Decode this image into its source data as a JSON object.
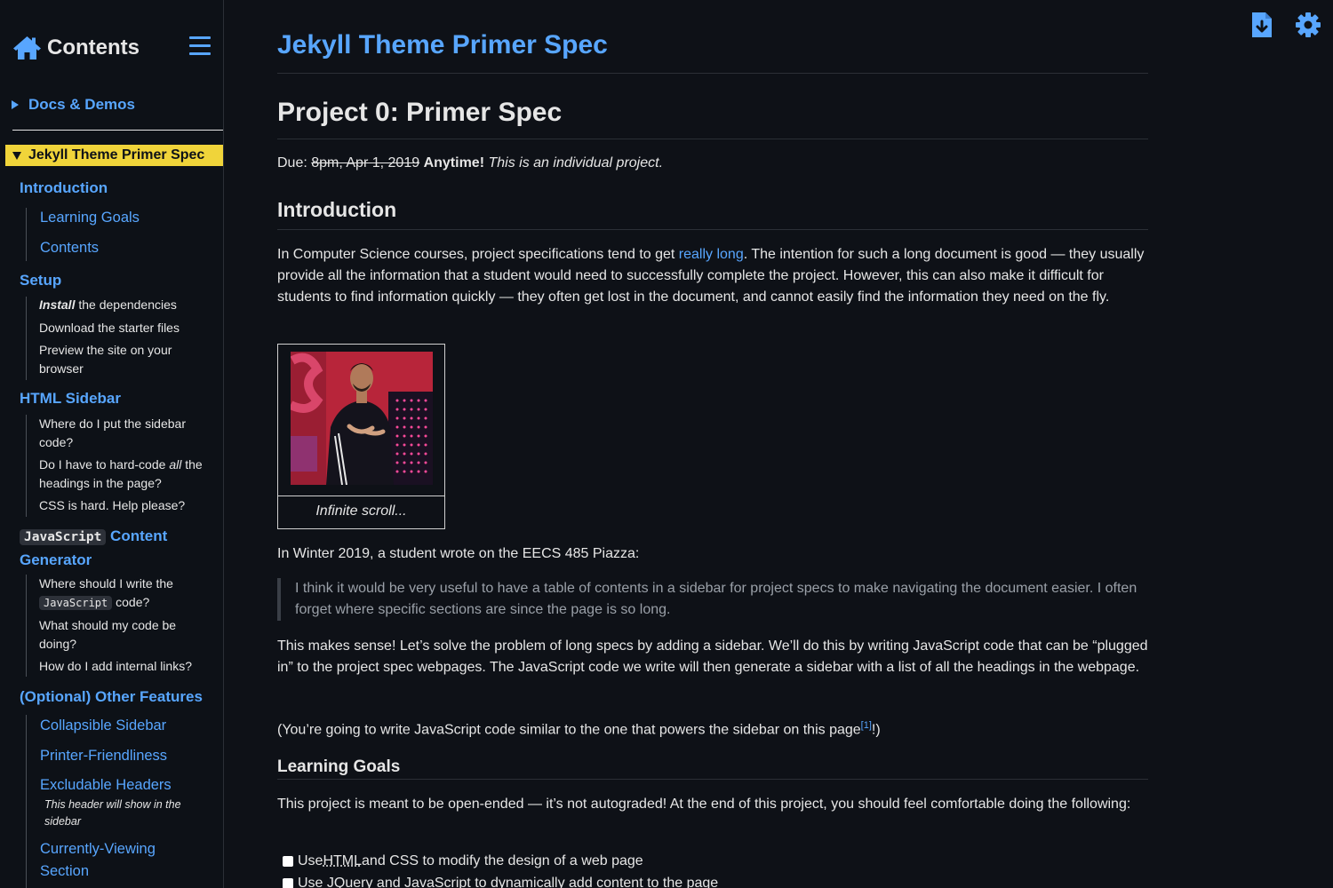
{
  "sidebar": {
    "title": "Contents",
    "docs_label": "Docs & Demos",
    "active_label": "Jekyll Theme Primer Spec",
    "intro": "Introduction",
    "learning_goals": "Learning Goals",
    "contents": "Contents",
    "setup": "Setup",
    "install_em": "Install",
    "install_rest": " the dependencies",
    "download": "Download the starter files",
    "preview": "Preview the site on your browser",
    "html_sidebar": "HTML Sidebar",
    "where_put": "Where do I put the sidebar code?",
    "hardcode_a": "Do I have to hard-code ",
    "hardcode_em": "all",
    "hardcode_b": " the headings in the page?",
    "css_hard": "CSS is hard. Help please?",
    "js_code": "JavaScript",
    "js_rest": "Content Generator",
    "where_write_a": "Where should I write the ",
    "where_write_code": "JavaScript",
    "where_write_b": " code?",
    "what_doing": "What should my code be doing?",
    "internal_links": "How do I add internal links?",
    "optional": "(Optional) Other Features",
    "collapsible": "Collapsible Sidebar",
    "printer": "Printer-Friendliness",
    "excludable": "Excludable Headers",
    "excludable_note": "This header will show in the sidebar",
    "currently": "Currently-Viewing Section"
  },
  "icons": {
    "home": "home-icon",
    "menu": "hamburger-menu-icon",
    "download": "download-file-icon",
    "settings": "gear-icon"
  },
  "main": {
    "site_title": "Jekyll Theme Primer Spec",
    "h1": "Project 0: Primer Spec",
    "due_label": "Due: ",
    "due_struck": "8pm, Apr 1, 2019",
    "due_bold": "Anytime!",
    "due_italic": "This is an individual project.",
    "intro_heading": "Introduction",
    "intro_p_a": "In Computer Science courses, project specifications tend to get ",
    "intro_p_link": "really long",
    "intro_p_b": ". The intention for such a long document is good — they usually provide all the information that a student would need to successfully complete the project. However, this can also make it difficult for students to find information quickly — they often get lost in the document, and cannot easily find the information they need on the fly.",
    "figure_caption": "Infinite scroll...",
    "piazza": "In Winter 2019, a student wrote on the EECS 485 Piazza:",
    "quote": "I think it would be very useful to have a table of contents in a sidebar for project specs to make navigating the document easier. I often forget where specific sections are since the page is so long.",
    "sense": "This makes sense! Let’s solve the problem of long specs by adding a sidebar. We’ll do this by writing JavaScript code that can be “plugged in” to the project spec webpages. The JavaScript code we write will then generate a sidebar with a list of all the headings in the webpage.",
    "similar_a": "(You’re going to write JavaScript code similar to the one that powers the sidebar on this page",
    "similar_sup": "[1]",
    "similar_b": "!)",
    "lg_heading": "Learning Goals",
    "lg_p": "This project is meant to be open-ended — it’s not autograded! At the end of this project, you should feel comfortable doing the following:",
    "cb1_a": "Use ",
    "cb1_abbr": "HTML",
    "cb1_b": " and CSS to modify the design of a web page",
    "cb2": "Use JQuery and JavaScript to dynamically add content to the page"
  }
}
